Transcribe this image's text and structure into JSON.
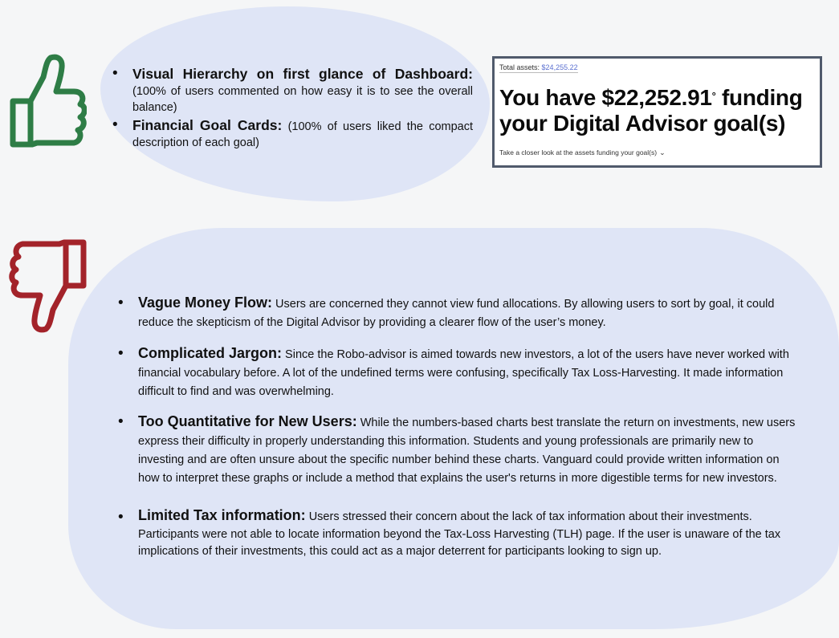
{
  "positive": {
    "items": [
      {
        "title": "Visual Hierarchy on first glance of Dashboard:",
        "text": " (100% of users commented on how easy it is to see the overall balance)"
      },
      {
        "title": "Financial Goal Cards:",
        "text": " (100% of  users liked the compact description of each goal)"
      }
    ]
  },
  "screenshot": {
    "assets_label": "Total assets:",
    "assets_value": "$24,255.22",
    "headline_pre": "You have $22,252.91",
    "headline_mark": "°",
    "headline_post": " funding your Digital Advisor goal(s)",
    "look_label": "Take a closer look at the assets funding your goal(s)",
    "look_icon": "chevron-down-icon"
  },
  "negative": {
    "items": [
      {
        "title": "Vague Money Flow:",
        "text": " Users are concerned they cannot view fund allocations. By allowing users to sort by goal, it could reduce the skepticism of the Digital Advisor by providing a clearer flow of the user’s money."
      },
      {
        "title": "Complicated Jargon:",
        "text": " Since the Robo-advisor is aimed towards new investors, a lot of the users have never worked with financial vocabulary before. A lot of the undefined terms were confusing, specifically Tax Loss-Harvesting. It made information difficult to find and was overwhelming."
      },
      {
        "title": "Too Quantitative for New Users:",
        "text": " While the numbers-based charts best translate the return on investments, new users express their difficulty in properly understanding this information. Students and young professionals are primarily new to investing and are often unsure about the specific number behind these charts. Vanguard could provide written information on how to interpret these graphs or include a method that explains the user's returns in more digestible terms for new investors."
      },
      {
        "title": "Limited Tax information:",
        "text": " Users stressed their concern about the lack of tax information about their investments. Participants were not able to locate information beyond the Tax-Loss Harvesting (TLH) page. If the user is unaware of the tax implications of their investments, this could act as a major deterrent for participants looking to sign up."
      }
    ]
  },
  "icons": {
    "positive": "thumbs-up-icon",
    "negative": "thumbs-down-icon"
  },
  "colors": {
    "thumbs_up": "#2e7d46",
    "thumbs_down": "#a3232a",
    "blob": "#dfe5f6",
    "screenshot_border": "#505a6c",
    "assets_value": "#5a6fd0"
  }
}
